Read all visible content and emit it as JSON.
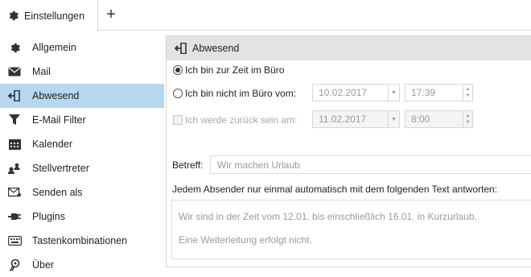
{
  "tab": {
    "label": "Einstellungen",
    "icon": "gear-icon",
    "add_label": "+"
  },
  "sidebar": {
    "items": [
      {
        "label": "Allgemein",
        "icon": "gear-icon"
      },
      {
        "label": "Mail",
        "icon": "envelope-icon"
      },
      {
        "label": "Abwesend",
        "icon": "door-exit-icon",
        "active": true
      },
      {
        "label": "E-Mail Filter",
        "icon": "filter-icon"
      },
      {
        "label": "Kalender",
        "icon": "calendar-icon"
      },
      {
        "label": "Stellvertreter",
        "icon": "people-icon"
      },
      {
        "label": "Senden als",
        "icon": "envelope-send-icon"
      },
      {
        "label": "Plugins",
        "icon": "plug-icon"
      },
      {
        "label": "Tastenkombinationen",
        "icon": "keyboard-icon"
      },
      {
        "label": "Über",
        "icon": "info-badge-icon"
      }
    ]
  },
  "panel": {
    "title": "Abwesend",
    "radio_in_office": "Ich bin zur Zeit im Büro",
    "radio_out_office": "Ich bin nicht im Büro vom:",
    "out_date": "10.02.2017",
    "out_time": "17:39",
    "return_label": "Ich werde zurück sein am:",
    "return_date": "11.02.2017",
    "return_time": "8:00",
    "subject_label": "Betreff:",
    "subject_placeholder": "Wir machen Urlaub",
    "reply_label": "Jedem Absender nur einmal automatisch mit dem folgenden Text antworten:",
    "reply_line1": "Wir sind in der Zeit vom 12.01. bis einschließlich 16.01. in  Kurzurlaub.",
    "reply_line2": "Eine Weiterleitung erfolgt nicht."
  },
  "colors": {
    "active_bg": "#b7d7ee",
    "header_bg": "#e3e3e3",
    "placeholder": "#9a9a9a"
  }
}
